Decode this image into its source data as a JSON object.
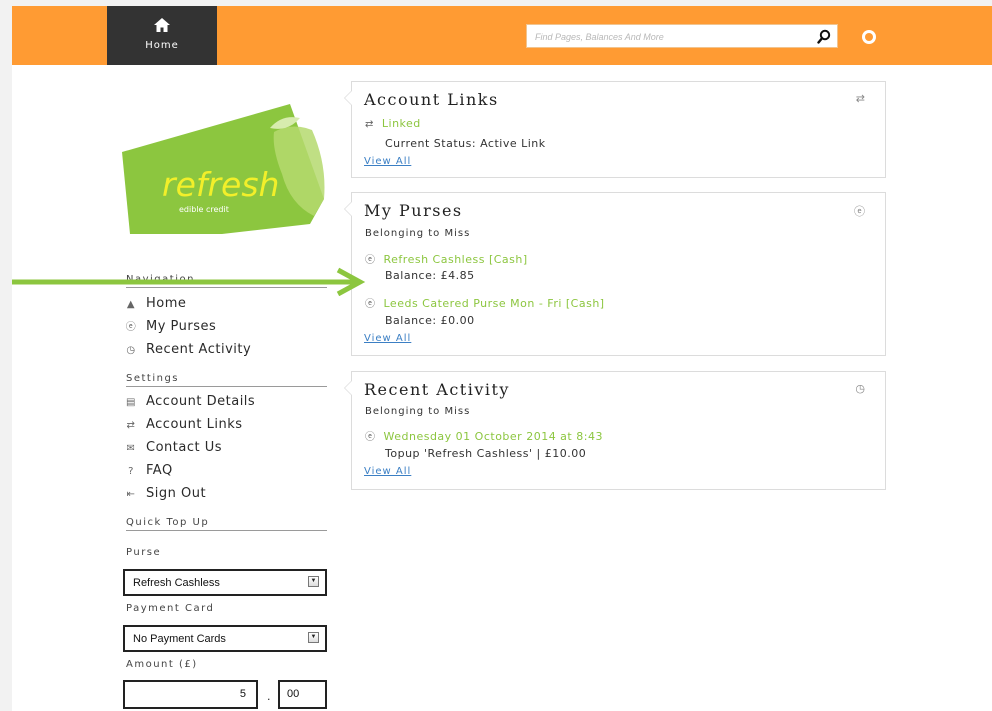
{
  "header": {
    "home_label": "Home",
    "search_placeholder": "Find Pages, Balances And More"
  },
  "logo": {
    "brand": "refresh",
    "tagline": "edible credit",
    "color": "#8cc63f"
  },
  "sidebar": {
    "nav_heading": "Navigation",
    "nav_items": [
      {
        "icon": "home-icon",
        "label": "Home"
      },
      {
        "icon": "purse-icon",
        "label": "My Purses"
      },
      {
        "icon": "clock-icon",
        "label": "Recent Activity"
      }
    ],
    "settings_heading": "Settings",
    "settings_items": [
      {
        "icon": "account-details-icon",
        "label": "Account Details"
      },
      {
        "icon": "link-icon",
        "label": "Account Links"
      },
      {
        "icon": "envelope-icon",
        "label": "Contact Us"
      },
      {
        "icon": "question-icon",
        "label": "FAQ"
      },
      {
        "icon": "sign-out-icon",
        "label": "Sign Out"
      }
    ],
    "quick_topup": {
      "heading": "Quick Top Up",
      "purse_label": "Purse",
      "purse_value": "Refresh Cashless",
      "card_label": "Payment Card",
      "card_value": "No Payment Cards",
      "amount_label": "Amount (£)",
      "amount_pounds": "5",
      "separator": ".",
      "amount_pence": "00"
    }
  },
  "account_links": {
    "title": "Account Links",
    "linked_label": "Linked",
    "status": "Current Status: Active Link",
    "view_all": "View All"
  },
  "my_purses": {
    "title": "My Purses",
    "belonging": "Belonging to Miss",
    "purses": [
      {
        "name": "Refresh Cashless [Cash]",
        "balance": "Balance: £4.85"
      },
      {
        "name": "Leeds Catered Purse Mon - Fri [Cash]",
        "balance": "Balance: £0.00"
      }
    ],
    "view_all": "View All"
  },
  "recent_activity": {
    "title": "Recent Activity",
    "belonging": "Belonging to Miss",
    "date": "Wednesday 01 October 2014 at 8:43",
    "detail": "Topup 'Refresh Cashless' | £10.00",
    "view_all": "View All"
  },
  "colors": {
    "header": "#ff9b33",
    "home_tab": "#333333",
    "accent_green": "#8cc63f",
    "link_blue": "#3b7fc4"
  }
}
